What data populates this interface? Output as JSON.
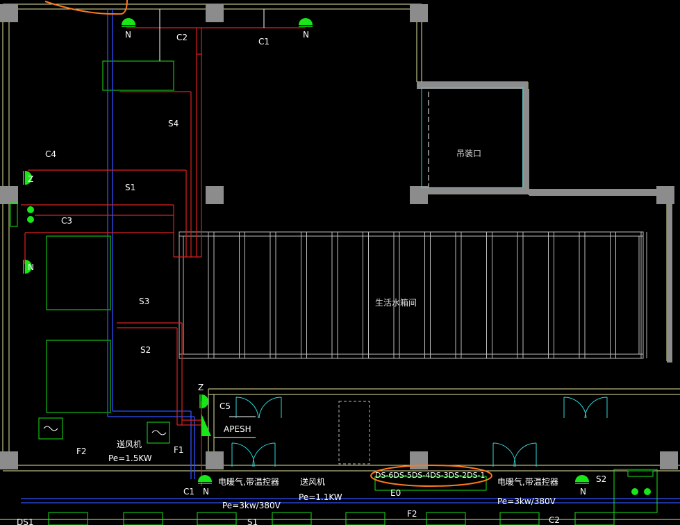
{
  "rooms": {
    "hoist_opening": "吊装口",
    "water_tank_room": "生活水箱间"
  },
  "circuits": {
    "c1_top": "C1",
    "c2_top": "C2",
    "c3": "C3",
    "c4": "C4",
    "c5": "C5",
    "s1": "S1",
    "s2_left": "S2",
    "s3": "S3",
    "s4": "S4",
    "f1": "F1",
    "f2": "F2",
    "c1_bottom": "C1",
    "s1_bottom": "S1",
    "f2_bottom": "F2",
    "c2_bottom": "C2",
    "s2_right": "S2",
    "e0": "E0",
    "ds1": "DS1"
  },
  "devices": {
    "n1": "N",
    "n2": "N",
    "n3": "N",
    "n4": "N",
    "n5": "N",
    "z1": "Z",
    "z2": "Z",
    "apesh": "APESH"
  },
  "equipment": {
    "fan_left_name": "送风机",
    "fan_left_power": "Pe=1.5KW",
    "fan_mid_name": "送风机",
    "fan_mid_power": "Pe=1.1KW",
    "heater_left_name": "电暖气,带温控器",
    "heater_left_power": "Pe=3kw/380V",
    "heater_right_name": "电暖气,带温控器",
    "heater_right_power": "Pe=3kw/380V"
  },
  "highlight": {
    "text": "DS-6DS-5DS-4DS-3DS-2DS-1"
  },
  "colors": {
    "background": "#000000",
    "wall": "#8c8c8c",
    "wall_outline": "#e6e6a0",
    "red_wire": "#e02020",
    "blue_wire": "#3050ff",
    "green_equipment": "#19e619",
    "cyan": "#30d8d8",
    "annotation": "#ff7a1a"
  }
}
